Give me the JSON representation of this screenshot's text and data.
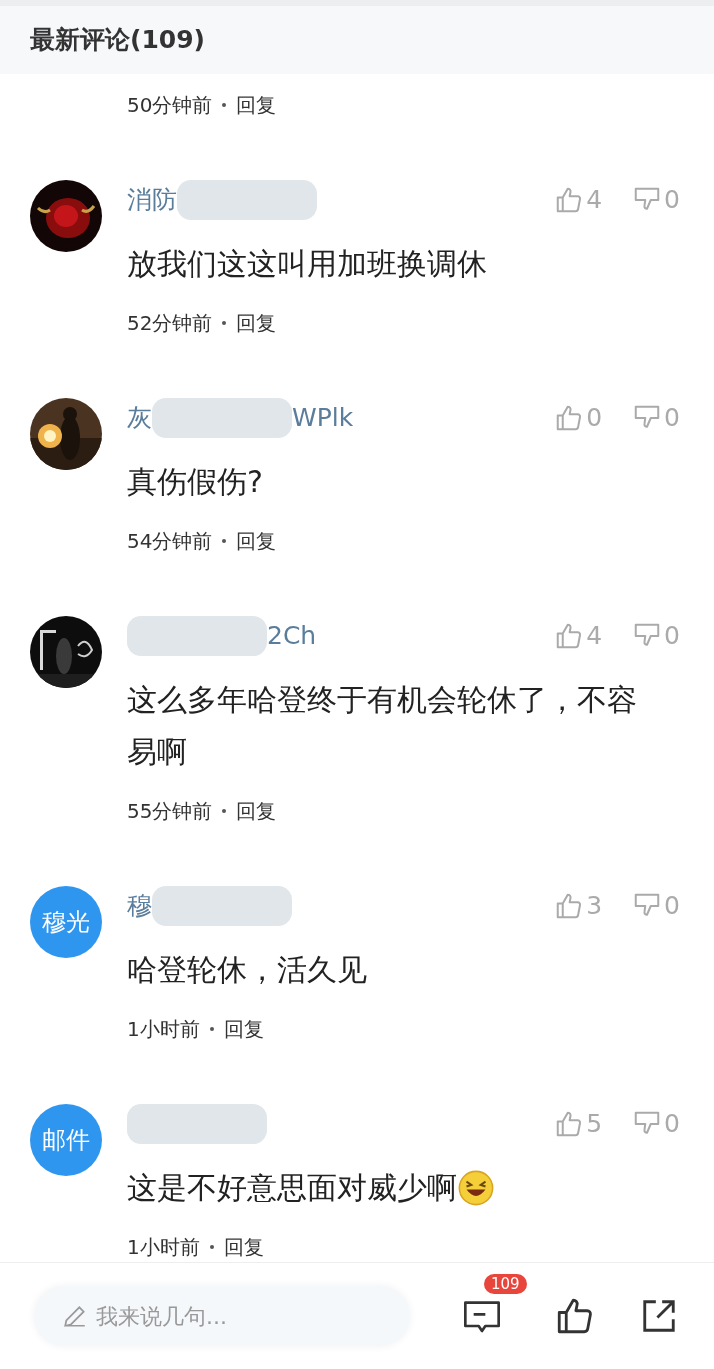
{
  "header": {
    "title": "最新评论(109)"
  },
  "partial_comment": {
    "time": "50分钟前",
    "reply": "回复"
  },
  "comments": [
    {
      "name": "消防",
      "likes": "4",
      "dislikes": "0",
      "text": "放我们这这叫用加班换调休",
      "emoji": false,
      "time": "52分钟前",
      "reply": "回复"
    },
    {
      "name": "灰",
      "name_suffix": "WPlk",
      "likes": "0",
      "dislikes": "0",
      "text": "真伤假伤?",
      "emoji": false,
      "time": "54分钟前",
      "reply": "回复"
    },
    {
      "name_suffix": "2Ch",
      "likes": "4",
      "dislikes": "0",
      "text": "这么多年哈登终于有机会轮休了，不容易啊",
      "emoji": false,
      "time": "55分钟前",
      "reply": "回复"
    },
    {
      "avatar": {
        "kind": "text",
        "label": "穆光"
      },
      "name": "穆",
      "likes": "3",
      "dislikes": "0",
      "text": "哈登轮休，活久见",
      "emoji": false,
      "time": "1小时前",
      "reply": "回复"
    },
    {
      "avatar": {
        "kind": "text",
        "label": "邮件"
      },
      "likes": "5",
      "dislikes": "0",
      "text": "这是不好意思面对威少啊",
      "emoji": true,
      "time": "1小时前",
      "reply": "回复"
    }
  ],
  "bottom_bar": {
    "input": {
      "placeholder": "我来说几句..."
    },
    "comment_badge": "109"
  }
}
